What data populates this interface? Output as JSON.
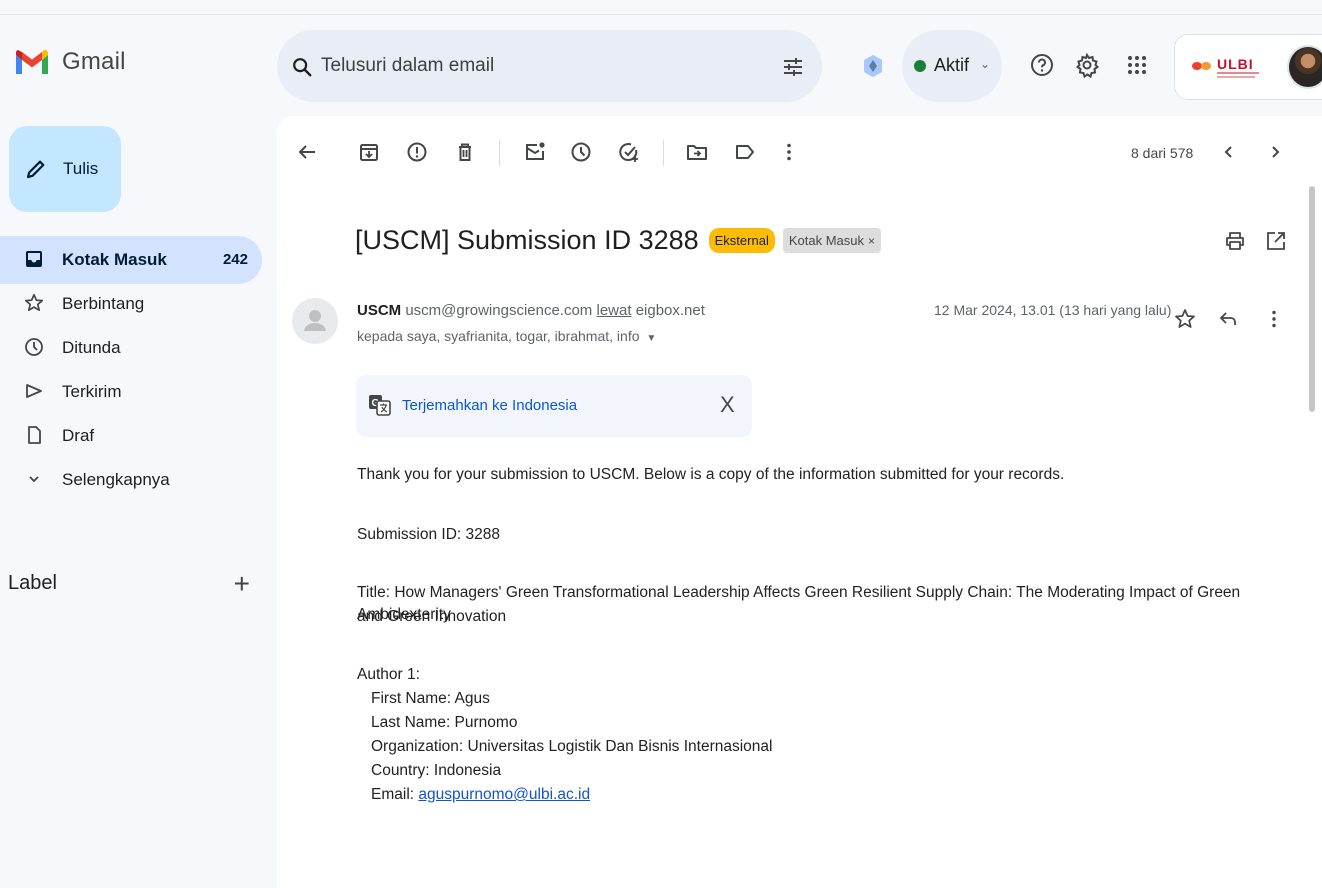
{
  "app": {
    "name": "Gmail"
  },
  "search": {
    "placeholder": "Telusuri dalam email"
  },
  "status": {
    "label": "Aktif"
  },
  "account": {
    "org_logo_text": "ULBI"
  },
  "compose": {
    "label": "Tulis"
  },
  "sidebar": {
    "items": [
      {
        "label": "Kotak Masuk",
        "count": "242",
        "icon": "inbox-icon",
        "active": true
      },
      {
        "label": "Berbintang",
        "icon": "star-icon"
      },
      {
        "label": "Ditunda",
        "icon": "clock-icon"
      },
      {
        "label": "Terkirim",
        "icon": "send-icon"
      },
      {
        "label": "Draf",
        "icon": "draft-icon"
      },
      {
        "label": "Selengkapnya",
        "icon": "chevron-down-icon"
      }
    ],
    "labels_title": "Label"
  },
  "toolbar": {
    "pager": "8 dari 578"
  },
  "email": {
    "subject": "[USCM] Submission ID 3288",
    "chip_external": "Eksternal",
    "chip_inbox": "Kotak Masuk",
    "chip_close": "×",
    "sender_name": "USCM",
    "sender_email": "uscm@growingscience.com",
    "via_label": "lewat",
    "via_domain": "eigbox.net",
    "recipients": "kepada saya, syafrianita, togar, ibrahmat, info",
    "date": "12 Mar 2024, 13.01 (13 hari yang lalu)",
    "translate_label": "Terjemahkan ke Indonesia",
    "translate_close": "X",
    "body": {
      "intro": "Thank you for your submission to USCM.  Below is a copy of the information submitted for your records.",
      "submission_id": "Submission ID: 3288",
      "title_line1": "Title: How Managers' Green Transformational Leadership Affects Green Resilient Supply Chain: The Moderating Impact of Green Ambidexterity",
      "title_line2": "and Green Innovation",
      "author_heading": "Author 1:",
      "first_name": "First Name: Agus",
      "last_name": "Last Name: Purnomo",
      "organization": "Organization: Universitas Logistik Dan Bisnis Internasional",
      "country": "Country: Indonesia",
      "email_label": "Email: ",
      "email_value": "aguspurnomo@ulbi.ac.id"
    }
  },
  "colors": {
    "compose_bg": "#c2e7ff",
    "active_nav_bg": "#d3e3fd",
    "external_chip": "#fbbc04",
    "status_dot": "#188038",
    "link": "#1155cc"
  }
}
